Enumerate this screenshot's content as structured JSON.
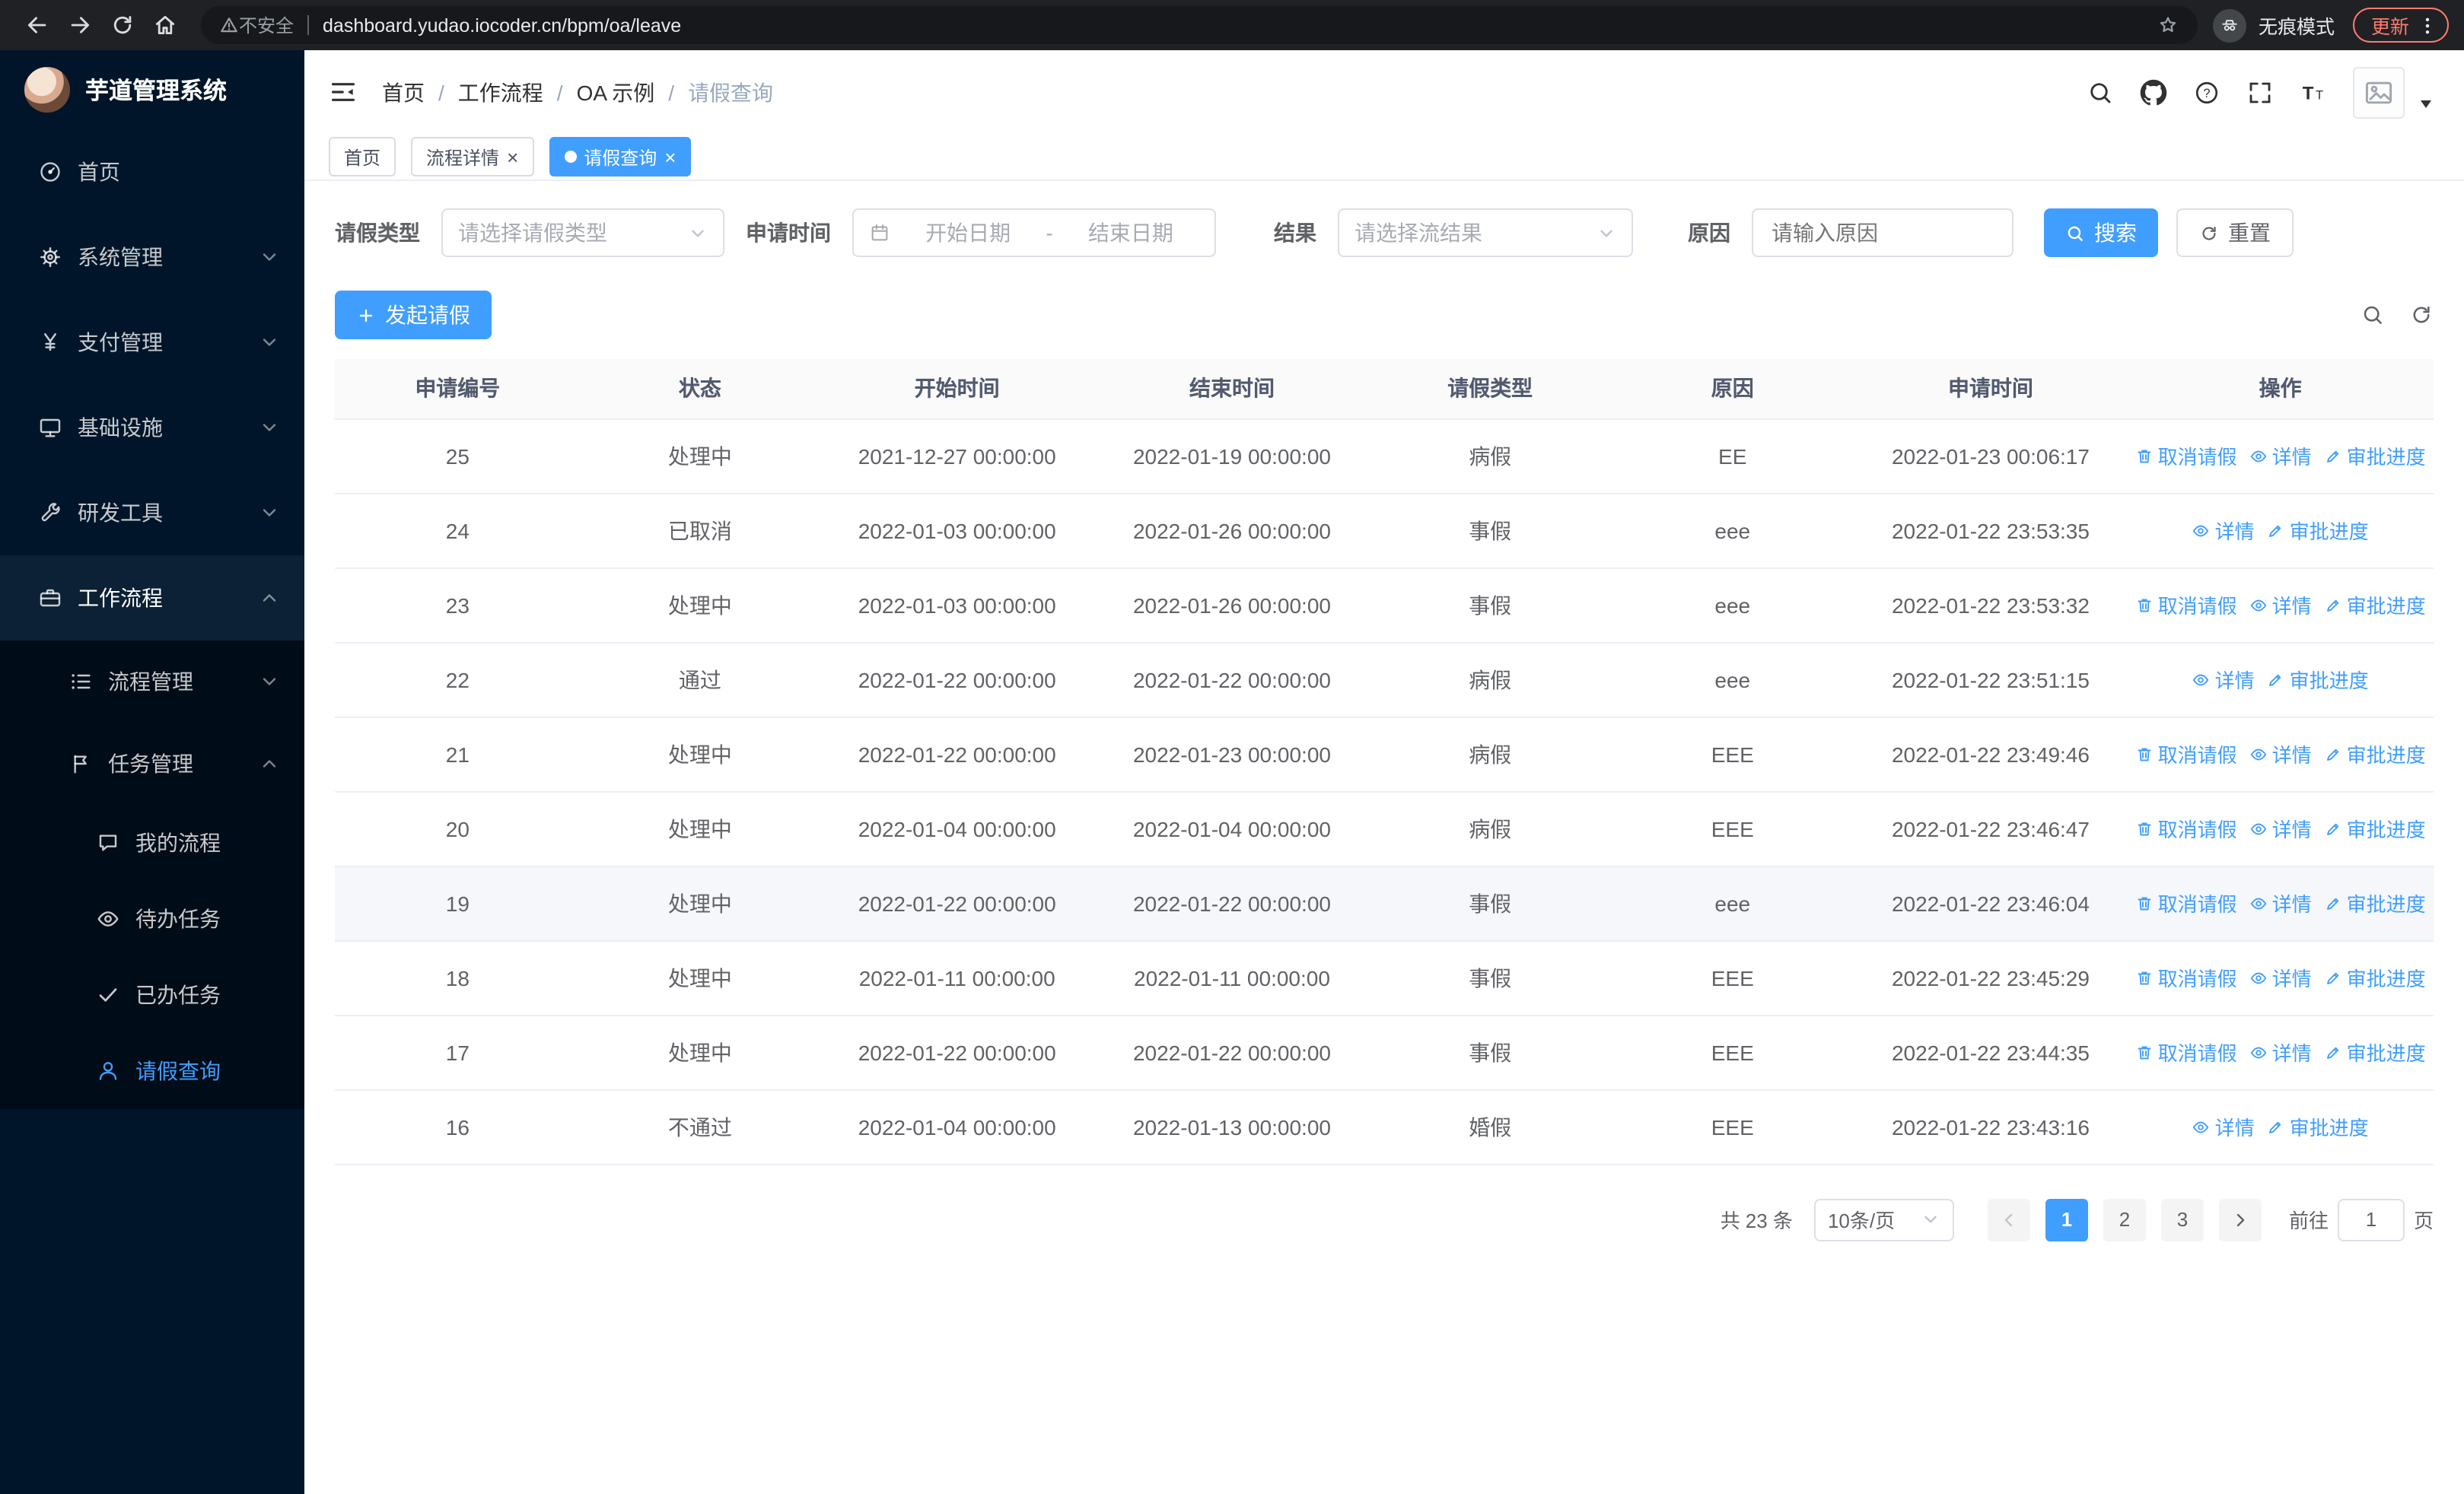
{
  "browser": {
    "security_label": "不安全",
    "url": "dashboard.yudao.iocoder.cn/bpm/oa/leave",
    "incognito_label": "无痕模式",
    "update_label": "更新"
  },
  "colors": {
    "primary": "#409eff",
    "sidebar_bg": "#001529",
    "browser_bar_bg": "#202124",
    "update_accent": "#ff7b6e",
    "table_header_bg": "#fafafa"
  },
  "icons": [
    "back-icon",
    "forward-icon",
    "reload-icon",
    "home-icon",
    "warning-triangle-icon",
    "bookmark-star-icon",
    "incognito-icon",
    "kebab-menu-icon",
    "dashboard-icon",
    "gear-icon",
    "yen-icon",
    "monitor-icon",
    "wrench-icon",
    "briefcase-icon",
    "flow-list-icon",
    "flag-icon",
    "chat-icon",
    "eye-icon",
    "check-icon",
    "user-icon",
    "collapse-menu-icon",
    "search-icon",
    "github-icon",
    "help-icon",
    "fullscreen-icon",
    "font-size-icon",
    "image-placeholder-icon",
    "caret-down-icon",
    "calendar-icon",
    "plus-icon",
    "refresh-icon",
    "trash-icon",
    "edit-icon"
  ],
  "sidebar": {
    "app_title": "芋道管理系统",
    "items": [
      {
        "label": "首页"
      },
      {
        "label": "系统管理"
      },
      {
        "label": "支付管理"
      },
      {
        "label": "基础设施"
      },
      {
        "label": "研发工具"
      },
      {
        "label": "工作流程"
      },
      {
        "label": "流程管理"
      },
      {
        "label": "任务管理"
      },
      {
        "label": "我的流程"
      },
      {
        "label": "待办任务"
      },
      {
        "label": "已办任务"
      },
      {
        "label": "请假查询"
      }
    ]
  },
  "header": {
    "breadcrumb": [
      "首页",
      "工作流程",
      "OA 示例",
      "请假查询"
    ]
  },
  "tabs": [
    {
      "label": "首页"
    },
    {
      "label": "流程详情"
    },
    {
      "label": "请假查询"
    }
  ],
  "filters": {
    "leave_type_label": "请假类型",
    "leave_type_placeholder": "请选择请假类型",
    "apply_time_label": "申请时间",
    "start_date_placeholder": "开始日期",
    "range_separator": "-",
    "end_date_placeholder": "结束日期",
    "result_label": "结果",
    "result_placeholder": "请选择流结果",
    "reason_label": "原因",
    "reason_placeholder": "请输入原因",
    "search_button": "搜索",
    "reset_button": "重置"
  },
  "toolbar": {
    "create_button": "发起请假"
  },
  "table": {
    "columns": [
      "申请编号",
      "状态",
      "开始时间",
      "结束时间",
      "请假类型",
      "原因",
      "申请时间",
      "操作"
    ],
    "action_labels": {
      "cancel": "取消请假",
      "detail": "详情",
      "progress": "审批进度"
    },
    "rows": [
      {
        "id": "25",
        "status": "处理中",
        "start": "2021-12-27 00:00:00",
        "end": "2022-01-19 00:00:00",
        "type": "病假",
        "reason": "EE",
        "applied": "2022-01-23 00:06:17",
        "cancelable": true,
        "highlighted": false
      },
      {
        "id": "24",
        "status": "已取消",
        "start": "2022-01-03 00:00:00",
        "end": "2022-01-26 00:00:00",
        "type": "事假",
        "reason": "eee",
        "applied": "2022-01-22 23:53:35",
        "cancelable": false,
        "highlighted": false
      },
      {
        "id": "23",
        "status": "处理中",
        "start": "2022-01-03 00:00:00",
        "end": "2022-01-26 00:00:00",
        "type": "事假",
        "reason": "eee",
        "applied": "2022-01-22 23:53:32",
        "cancelable": true,
        "highlighted": false
      },
      {
        "id": "22",
        "status": "通过",
        "start": "2022-01-22 00:00:00",
        "end": "2022-01-22 00:00:00",
        "type": "病假",
        "reason": "eee",
        "applied": "2022-01-22 23:51:15",
        "cancelable": false,
        "highlighted": false
      },
      {
        "id": "21",
        "status": "处理中",
        "start": "2022-01-22 00:00:00",
        "end": "2022-01-23 00:00:00",
        "type": "病假",
        "reason": "EEE",
        "applied": "2022-01-22 23:49:46",
        "cancelable": true,
        "highlighted": false
      },
      {
        "id": "20",
        "status": "处理中",
        "start": "2022-01-04 00:00:00",
        "end": "2022-01-04 00:00:00",
        "type": "病假",
        "reason": "EEE",
        "applied": "2022-01-22 23:46:47",
        "cancelable": true,
        "highlighted": false
      },
      {
        "id": "19",
        "status": "处理中",
        "start": "2022-01-22 00:00:00",
        "end": "2022-01-22 00:00:00",
        "type": "事假",
        "reason": "eee",
        "applied": "2022-01-22 23:46:04",
        "cancelable": true,
        "highlighted": true
      },
      {
        "id": "18",
        "status": "处理中",
        "start": "2022-01-11 00:00:00",
        "end": "2022-01-11 00:00:00",
        "type": "事假",
        "reason": "EEE",
        "applied": "2022-01-22 23:45:29",
        "cancelable": true,
        "highlighted": false
      },
      {
        "id": "17",
        "status": "处理中",
        "start": "2022-01-22 00:00:00",
        "end": "2022-01-22 00:00:00",
        "type": "事假",
        "reason": "EEE",
        "applied": "2022-01-22 23:44:35",
        "cancelable": true,
        "highlighted": false
      },
      {
        "id": "16",
        "status": "不通过",
        "start": "2022-01-04 00:00:00",
        "end": "2022-01-13 00:00:00",
        "type": "婚假",
        "reason": "EEE",
        "applied": "2022-01-22 23:43:16",
        "cancelable": false,
        "highlighted": false
      }
    ]
  },
  "pagination": {
    "total": "共 23 条",
    "page_size": "10条/页",
    "pages": [
      "1",
      "2",
      "3"
    ],
    "active_page": "1",
    "goto_label": "前往",
    "goto_value": "1",
    "goto_suffix": "页"
  }
}
